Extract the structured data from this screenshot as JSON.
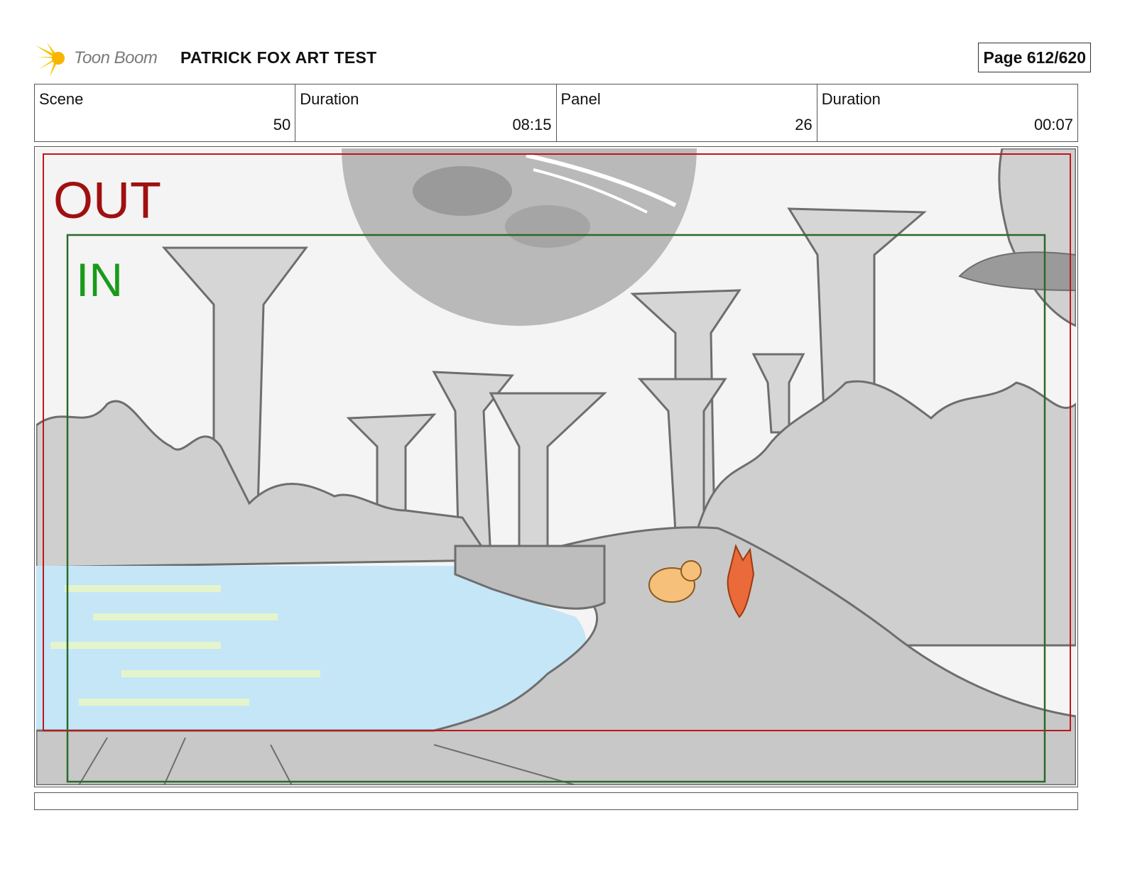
{
  "header": {
    "logo_text": "Toon Boom",
    "project_title": "PATRICK FOX ART TEST",
    "page_label": "Page 612/620"
  },
  "info": [
    {
      "label": "Scene",
      "value": "50"
    },
    {
      "label": "Duration",
      "value": "08:15"
    },
    {
      "label": "Panel",
      "value": "26"
    },
    {
      "label": "Duration",
      "value": "00:07"
    }
  ],
  "panel": {
    "out_label": "OUT",
    "in_label": "IN",
    "out_color": "#a01010",
    "in_color": "#1a9a1a"
  },
  "dialogue": ""
}
